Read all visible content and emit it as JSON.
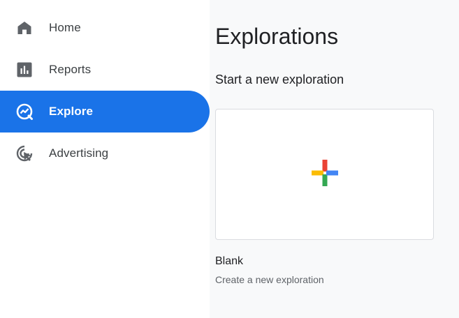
{
  "sidebar": {
    "items": [
      {
        "label": "Home",
        "icon": "home-icon",
        "active": false
      },
      {
        "label": "Reports",
        "icon": "bar-chart-icon",
        "active": false
      },
      {
        "label": "Explore",
        "icon": "explore-icon",
        "active": true
      },
      {
        "label": "Advertising",
        "icon": "advertising-icon",
        "active": false
      }
    ]
  },
  "main": {
    "title": "Explorations",
    "subheading": "Start a new exploration",
    "template_card": {
      "icon": "plus-icon",
      "title": "Blank",
      "description": "Create a new exploration"
    }
  },
  "colors": {
    "accent": "#1a73e8",
    "icon_gray": "#5f6368",
    "plus_red": "#ea4335",
    "plus_yellow": "#fbbc04",
    "plus_green": "#34a853",
    "plus_blue": "#4285f4"
  }
}
